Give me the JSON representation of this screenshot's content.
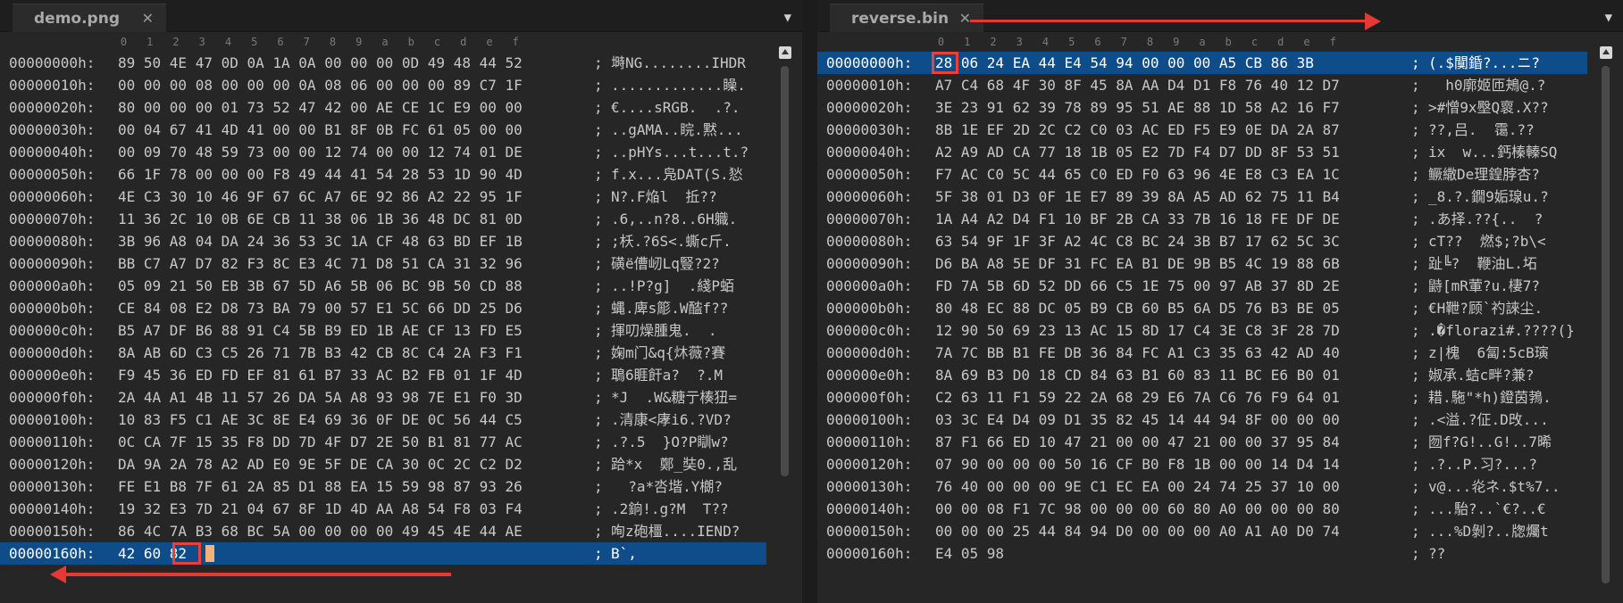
{
  "ruler": [
    "0",
    "1",
    "2",
    "3",
    "4",
    "5",
    "6",
    "7",
    "8",
    "9",
    "a",
    "b",
    "c",
    "d",
    "e",
    "f"
  ],
  "left": {
    "tab_title": "demo.png",
    "close_glyph": "✕",
    "menu_glyph": "▼",
    "selected_row": 22,
    "rows": [
      {
        "addr": "00000000h:",
        "hex": "89 50 4E 47 0D 0A 1A 0A 00 00 00 0D 49 48 44 52",
        "sep": ";",
        "asc": "塒NG........IHDR"
      },
      {
        "addr": "00000010h:",
        "hex": "00 00 00 08 00 00 00 0A 08 06 00 00 00 89 C7 1F",
        "sep": ";",
        "asc": ".............矂."
      },
      {
        "addr": "00000020h:",
        "hex": "80 00 00 00 01 73 52 47 42 00 AE CE 1C E9 00 00",
        "sep": ";",
        "asc": "€....sRGB.  .?."
      },
      {
        "addr": "00000030h:",
        "hex": "00 04 67 41 4D 41 00 00 B1 8F 0B FC 61 05 00 00",
        "sep": ";",
        "asc": "..gAMA..睆.黙..."
      },
      {
        "addr": "00000040h:",
        "hex": "00 09 70 48 59 73 00 00 12 74 00 00 12 74 01 DE",
        "sep": ";",
        "asc": "..pHYs...t...t.?"
      },
      {
        "addr": "00000050h:",
        "hex": "66 1F 78 00 00 00 F8 49 44 41 54 28 53 1D 90 4D",
        "sep": ";",
        "asc": "f.x...凫DAT(S.悐"
      },
      {
        "addr": "00000060h:",
        "hex": "4E C3 30 10 46 9F 67 6C A7 6E 92 86 A2 22 95 1F",
        "sep": ";",
        "asc": "N?.F焔l  拞??"
      },
      {
        "addr": "00000070h:",
        "hex": "11 36 2C 10 0B 6E CB 11 38 06 1B 36 48 DC 81 0D",
        "sep": ";",
        "asc": ".6,..n?8..6H軄."
      },
      {
        "addr": "00000080h:",
        "hex": "3B 96 A8 04 DA 24 36 53 3C 1A CF 48 63 BD EF 1B",
        "sep": ";",
        "asc": ";枖.?6S<.蟖c斤."
      },
      {
        "addr": "00000090h:",
        "hex": "BB C7 A7 D7 82 F3 8C E3 4C 71 D8 51 CA 31 32 96",
        "sep": ";",
        "asc": "磺ё傮屻Lq豎?2?"
      },
      {
        "addr": "000000a0h:",
        "hex": "05 09 21 50 EB 3B 67 5D A6 5B 06 BC 9B 50 CD 88",
        "sep": ";",
        "asc": "..!P?g]  .綫P蛨"
      },
      {
        "addr": "000000b0h:",
        "hex": "CE 84 08 E2 D8 73 BA 79 00 57 E1 5C 66 DD 25 D6",
        "sep": ";",
        "asc": "蝿.庳s簓.W醓f??"
      },
      {
        "addr": "000000c0h:",
        "hex": "B5 A7 DF B6 88 91 C4 5B B9 ED 1B AE CF 13 FD E5",
        "sep": ";",
        "asc": "揮叨燥腫鬼.  ."
      },
      {
        "addr": "000000d0h:",
        "hex": "8A AB 6D C3 C5 26 71 7B B3 42 CB 8C C4 2A F3 F1",
        "sep": ";",
        "asc": "婅m门&q{炑薇?賽"
      },
      {
        "addr": "000000e0h:",
        "hex": "F9 45 36 ED FD EF 81 61 B7 33 AC B2 FB 01 1F 4D",
        "sep": ";",
        "asc": "鵈6睚飦a?  ?.M"
      },
      {
        "addr": "000000f0h:",
        "hex": "2A 4A A1 4B 11 57 26 DA 5A A8 93 98 7E E1 F0 3D",
        "sep": ";",
        "asc": "*J  .W&糖亍楱狃="
      },
      {
        "addr": "00000100h:",
        "hex": "10 83 F5 C1 AE 3C 8E E4 69 36 0F DE 0C 56 44 C5",
        "sep": ";",
        "asc": ".清康<庨i6.?VD?"
      },
      {
        "addr": "00000110h:",
        "hex": "0C CA 7F 15 35 F8 DD 7D 4F D7 2E 50 B1 81 77 AC",
        "sep": ";",
        "asc": ".?.5  }O?P瞓w?"
      },
      {
        "addr": "00000120h:",
        "hex": "DA 9A 2A 78 A2 AD E0 9E 5F DE CA 30 0C 2C C2 D2",
        "sep": ";",
        "asc": "跲*x  鄭_奘0.,乱"
      },
      {
        "addr": "00000130h:",
        "hex": "FE E1 B8 7F 61 2A 85 D1 88 EA 15 59 98 87 93 26",
        "sep": ";",
        "asc": "  ?a*呇堦.Y樃?"
      },
      {
        "addr": "00000140h:",
        "hex": "19 32 E3 7D 21 04 67 8F 1D 4D AA A8 54 F8 03 F4",
        "sep": ";",
        "asc": ".2銄!.g?M  T??"
      },
      {
        "addr": "00000150h:",
        "hex": "86 4C 7A B3 68 BC 5A 00 00 00 00 49 45 4E 44 AE",
        "sep": ";",
        "asc": "咰z砲橿....IEND?"
      },
      {
        "addr": "00000160h:",
        "hex": "42 60 82",
        "sep": ";",
        "asc": "B`‚"
      }
    ]
  },
  "right": {
    "tab_title": "reverse.bin",
    "close_glyph": "✕",
    "menu_glyph": "▼",
    "selected_row": 0,
    "rows": [
      {
        "addr": "00000000h:",
        "hex": "28 06 24 EA 44 E4 54 94 00 00 00 A5 CB 86 3B",
        "sep": ";",
        "asc": "(.$闃錉?...ニ?"
      },
      {
        "addr": "00000010h:",
        "hex": "A7 C4 68 4F 30 8F 45 8A AA D4 D1 F8 76 40 12 D7",
        "sep": ";",
        "asc": "  h0廓姬匝鴂@.?"
      },
      {
        "addr": "00000020h:",
        "hex": "3E 23 91 62 39 78 89 95 51 AE 88 1D 58 A2 16 F7",
        "sep": ";",
        "asc": ">#憎9x壂Q褱.X??"
      },
      {
        "addr": "00000030h:",
        "hex": "8B 1E EF 2D 2C C2 C0 03 AC ED F5 E9 0E DA 2A 87",
        "sep": ";",
        "asc": "??,吕.  霭.??"
      },
      {
        "addr": "00000040h:",
        "hex": "A2 A9 AD CA 77 18 1B 05 E2 7D F4 D7 DD 8F 53 51",
        "sep": ";",
        "asc": "ix  w...鈣榛轃SQ"
      },
      {
        "addr": "00000050h:",
        "hex": "F7 AC C0 5C 44 65 C0 ED F0 63 96 4E E8 C3 EA 1C",
        "sep": ";",
        "asc": "鳜繖De理鍠脖杏?"
      },
      {
        "addr": "00000060h:",
        "hex": "5F 38 01 D3 0F 1E E7 89 39 8A A5 AD 62 75 11 B4",
        "sep": ";",
        "asc": "_8.?.鐗9姤瑔u.?"
      },
      {
        "addr": "00000070h:",
        "hex": "1A A4 A2 D4 F1 10 BF 2B CA 33 7B 16 18 FE DF DE",
        "sep": ";",
        "asc": ".あ择.??{..  ?"
      },
      {
        "addr": "00000080h:",
        "hex": "63 54 9F 1F 3F A2 4C C8 BC 24 3B B7 17 62 5C 3C",
        "sep": ";",
        "asc": "cT??  燃$;?b\\<"
      },
      {
        "addr": "00000090h:",
        "hex": "D6 BA A8 5E DF 31 FC EA B1 DE 9B B5 4C 19 88 6B",
        "sep": ";",
        "asc": "趾╚?  鞭油L.坧"
      },
      {
        "addr": "000000a0h:",
        "hex": "FD 7A 5B 6D 52 DD 66 C5 1E 75 00 97 AB 37 8D 2E",
        "sep": ";",
        "asc": "鼭[mR葷?u.棲7?"
      },
      {
        "addr": "000000b0h:",
        "hex": "80 48 EC 88 DC 05 B9 CB 60 B5 6A D5 76 B3 BE 05",
        "sep": ";",
        "asc": "€H靾?顾`礿誺尘."
      },
      {
        "addr": "000000c0h:",
        "hex": "12 90 50 69 23 13 AC 15 8D 17 C4 3E C8 3F 28 7D",
        "sep": ";",
        "asc": ".�florazi#.????(}"
      },
      {
        "addr": "000000d0h:",
        "hex": "7A 7C BB B1 FE DB 36 84 FC A1 C3 35 63 42 AD 40",
        "sep": ";",
        "asc": "z|槐  6匐:5cB璌"
      },
      {
        "addr": "000000e0h:",
        "hex": "8A 69 B3 D0 18 CD 84 63 B1 60 83 11 BC E6 B0 01",
        "sep": ";",
        "asc": "婌承.蛣c畔?兼?"
      },
      {
        "addr": "000000f0h:",
        "hex": "C2 63 11 F1 59 22 2A 68 29 E6 7A C6 76 F9 64 01",
        "sep": ";",
        "asc": "耤.駞\"*h)鐙茵鵓."
      },
      {
        "addr": "00000100h:",
        "hex": "03 3C E4 D4 09 D1 35 82 45 14 44 94 8F 00 00 00",
        "sep": ";",
        "asc": ".<溢.?佂.D攺..."
      },
      {
        "addr": "00000110h:",
        "hex": "87 F1 66 ED 10 47 21 00 00 47 21 00 00 37 95 84",
        "sep": ";",
        "asc": "囫f?G!..G!..7晞"
      },
      {
        "addr": "00000120h:",
        "hex": "07 90 00 00 00 50 16 CF B0 F8 1B 00 00 14 D4 14",
        "sep": ";",
        "asc": ".?..P.习?...?"
      },
      {
        "addr": "00000130h:",
        "hex": "76 40 00 00 00 9E C1 EC EA 00 24 74 25 37 10 00",
        "sep": ";",
        "asc": "v@...炛ネ.$t%7.."
      },
      {
        "addr": "00000140h:",
        "hex": "00 00 08 F1 7C 98 00 00 00 60 80 A0 00 00 00 80",
        "sep": ";",
        "asc": "...駘?..`€?..€"
      },
      {
        "addr": "00000150h:",
        "hex": "00 00 00 25 44 84 94 D0 00 00 00 A0 A1 A0 D0 74",
        "sep": ";",
        "asc": "...%D剝?..牎爥t"
      },
      {
        "addr": "00000160h:",
        "hex": "E4 05 98",
        "sep": ";",
        "asc": "??"
      }
    ]
  },
  "colors": {
    "selection": "#0f4c8a",
    "annotation": "#e53935",
    "cursor_box": "#e8403a",
    "caret": "#f4b27a"
  }
}
